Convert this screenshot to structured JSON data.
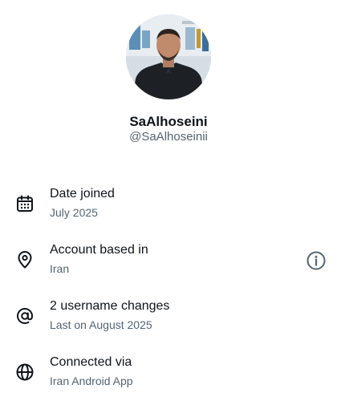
{
  "profile": {
    "display_name": "SaAlhoseini",
    "handle": "@SaAlhoseinii"
  },
  "details": [
    {
      "icon": "calendar-icon",
      "title": "Date joined",
      "value": "July 2025"
    },
    {
      "icon": "location-pin-icon",
      "title": "Account based in",
      "value": "Iran",
      "action_icon": "info-icon"
    },
    {
      "icon": "at-sign-icon",
      "title": "2 username changes",
      "value": "Last on August 2025"
    },
    {
      "icon": "globe-icon",
      "title": "Connected via",
      "value": "Iran Android App"
    }
  ],
  "colors": {
    "primary_text": "#0f1419",
    "secondary_text": "#536471",
    "background": "#ffffff"
  }
}
